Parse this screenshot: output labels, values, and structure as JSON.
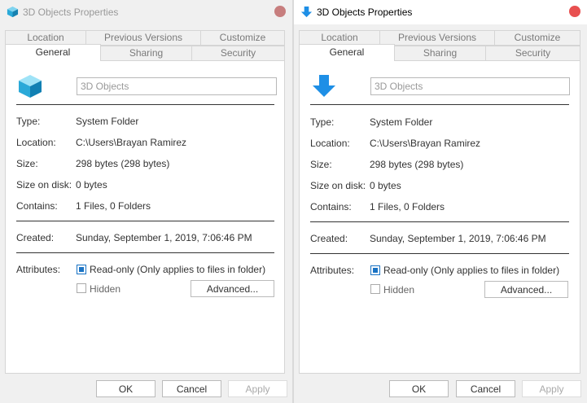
{
  "colors": {
    "accent": "#1a73c4",
    "close": "#e85050",
    "cube": "#2aa9d8"
  },
  "windows": [
    {
      "title": "3D Objects Properties",
      "icon": "cube-icon",
      "tabs": {
        "row1": [
          "Location",
          "Previous Versions",
          "Customize"
        ],
        "row2": [
          "General",
          "Sharing",
          "Security"
        ],
        "active": "General"
      },
      "folder_name": "3D Objects",
      "rows": [
        {
          "label": "Type:",
          "value": "System Folder"
        },
        {
          "label": "Location:",
          "value": "C:\\Users\\Brayan Ramirez"
        },
        {
          "label": "Size:",
          "value": "298 bytes (298 bytes)"
        },
        {
          "label": "Size on disk:",
          "value": "0 bytes"
        },
        {
          "label": "Contains:",
          "value": "1 Files, 0 Folders"
        }
      ],
      "created": {
        "label": "Created:",
        "value": "Sunday, September 1, 2019, 7:06:46 PM"
      },
      "attributes": {
        "label": "Attributes:",
        "readonly": "Read-only (Only applies to files in folder)",
        "hidden": "Hidden",
        "advanced": "Advanced..."
      },
      "buttons": {
        "ok": "OK",
        "cancel": "Cancel",
        "apply": "Apply"
      }
    },
    {
      "title": "3D Objects Properties",
      "icon": "arrow-down-icon",
      "tabs": {
        "row1": [
          "Location",
          "Previous Versions",
          "Customize"
        ],
        "row2": [
          "General",
          "Sharing",
          "Security"
        ],
        "active": "General"
      },
      "folder_name": "3D Objects",
      "rows": [
        {
          "label": "Type:",
          "value": "System Folder"
        },
        {
          "label": "Location:",
          "value": "C:\\Users\\Brayan Ramirez"
        },
        {
          "label": "Size:",
          "value": "298 bytes (298 bytes)"
        },
        {
          "label": "Size on disk:",
          "value": "0 bytes"
        },
        {
          "label": "Contains:",
          "value": "1 Files, 0 Folders"
        }
      ],
      "created": {
        "label": "Created:",
        "value": "Sunday, September 1, 2019, 7:06:46 PM"
      },
      "attributes": {
        "label": "Attributes:",
        "readonly": "Read-only (Only applies to files in folder)",
        "hidden": "Hidden",
        "advanced": "Advanced..."
      },
      "buttons": {
        "ok": "OK",
        "cancel": "Cancel",
        "apply": "Apply"
      }
    }
  ]
}
